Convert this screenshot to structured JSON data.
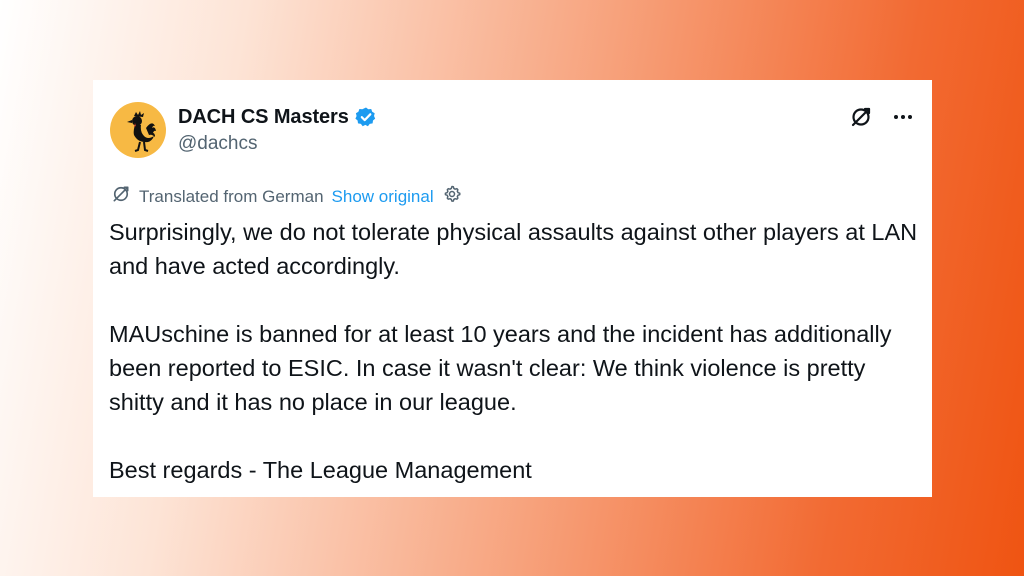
{
  "tweet": {
    "author": {
      "display_name": "DACH CS Masters",
      "handle": "@dachcs",
      "verified": true,
      "avatar_icon": "rooster-icon"
    },
    "actions": {
      "translate_icon": "translate-icon",
      "more_icon": "more-icon"
    },
    "translation": {
      "label": "Translated from German",
      "show_original": "Show original",
      "settings_icon": "gear-icon"
    },
    "paragraphs": [
      "Surprisingly, we do not tolerate physical assaults against other players at LAN and have acted accordingly.",
      "MAUschine is banned for at least 10 years and the incident has additionally been reported to ESIC. In case it wasn't clear: We think violence is pretty shitty and it has no place in our league.",
      "Best regards - The League Management"
    ]
  },
  "colors": {
    "verified_badge": "#1d9bf0",
    "link": "#1d9bf0",
    "text": "#0f1419",
    "muted": "#536471",
    "avatar_bg": "#f7b944",
    "background_gradient_end": "#ef5412"
  }
}
